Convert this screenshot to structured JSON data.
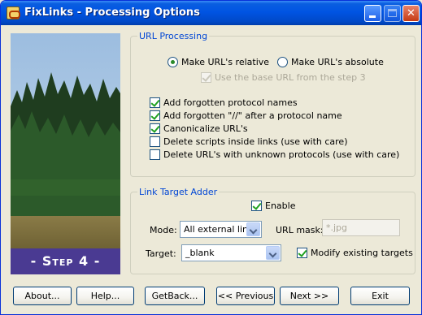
{
  "window": {
    "title": "FixLinks - Processing Options"
  },
  "step": {
    "label": "- Step 4 -"
  },
  "url_processing": {
    "legend": "URL Processing",
    "radio_relative": "Make URL's relative",
    "radio_absolute": "Make URL's absolute",
    "use_base_url": "Use the base URL from the step 3",
    "checks": [
      {
        "label": "Add forgotten protocol names",
        "checked": true
      },
      {
        "label": "Add forgotten \"//\" after a protocol name",
        "checked": true
      },
      {
        "label": "Canonicalize URL's",
        "checked": true
      },
      {
        "label": "Delete scripts inside links (use with care)",
        "checked": false
      },
      {
        "label": "Delete URL's with unknown protocols (use with care)",
        "checked": false
      }
    ]
  },
  "link_target": {
    "legend": "Link Target Adder",
    "enable": "Enable",
    "mode_label": "Mode:",
    "mode_value": "All external links",
    "url_mask_label": "URL mask:",
    "url_mask_value": "*.jpg",
    "target_label": "Target:",
    "target_value": "_blank",
    "modify_existing": "Modify existing targets"
  },
  "buttons": {
    "about": "About...",
    "help": "Help...",
    "getback": "GetBack...",
    "previous": "<< Previous",
    "next": "Next >>",
    "exit": "Exit"
  },
  "colors": {
    "title_bar": "#0054e3",
    "legend": "#0046d5",
    "banner": "#4a3a92"
  }
}
